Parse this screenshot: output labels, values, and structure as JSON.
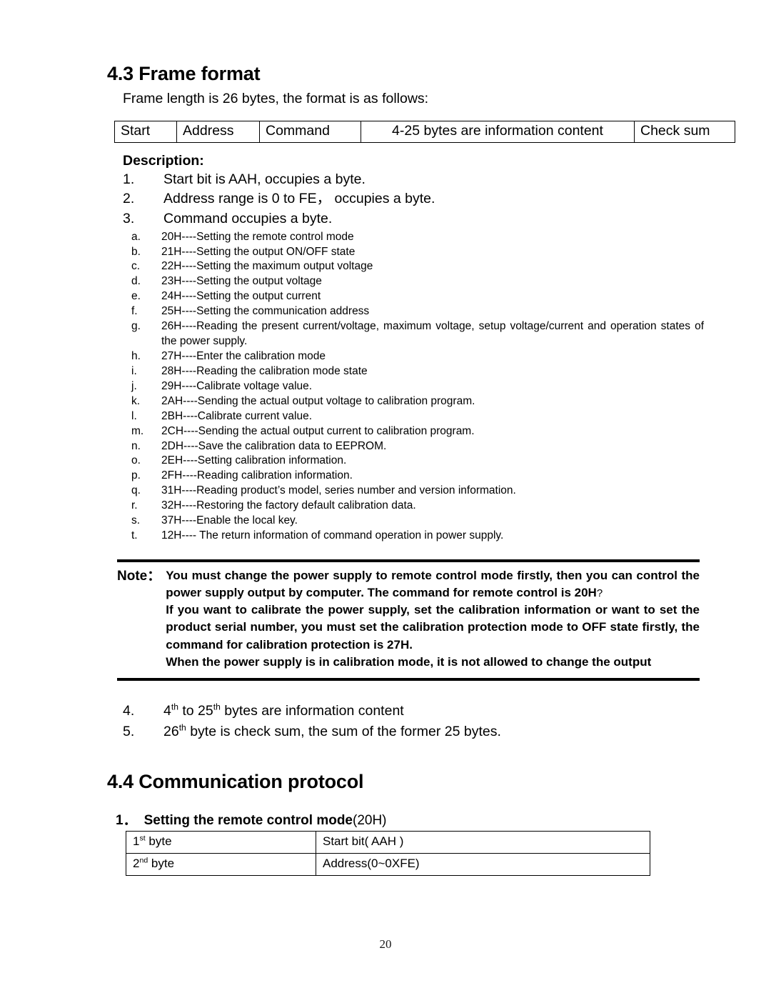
{
  "document": {
    "page_number": "20"
  },
  "section_43": {
    "heading": "4.3 Frame format",
    "intro": "Frame length is 26 bytes, the format is as follows:",
    "frame_table": {
      "cells": [
        "Start",
        "Address",
        "Command",
        "4-25 bytes are information content",
        "Check sum"
      ]
    },
    "description_title": "Description:",
    "numbered_items": [
      {
        "num": "1.",
        "text": "Start bit is AAH, occupies a byte."
      },
      {
        "num": "2.",
        "text": "Address range is 0 to FE， occupies a byte."
      },
      {
        "num": "3.",
        "text": "Command occupies a byte."
      }
    ],
    "command_list": [
      {
        "letter": "a.",
        "text": "20H----Setting the remote control mode"
      },
      {
        "letter": "b.",
        "text": "21H----Setting the output ON/OFF state"
      },
      {
        "letter": "c.",
        "text": "22H----Setting the maximum output voltage"
      },
      {
        "letter": "d.",
        "text": "23H----Setting the output voltage"
      },
      {
        "letter": "e.",
        "text": "24H----Setting the output current"
      },
      {
        "letter": "f.",
        "text": "25H----Setting the communication address"
      },
      {
        "letter": "g.",
        "text": "26H----Reading the present current/voltage, maximum voltage, setup voltage/current and operation states of the power supply."
      },
      {
        "letter": "h.",
        "text": "27H----Enter the calibration mode"
      },
      {
        "letter": "i.",
        "text": "28H----Reading the calibration mode state"
      },
      {
        "letter": "j.",
        "text": "29H----Calibrate voltage value."
      },
      {
        "letter": "k.",
        "text": "2AH----Sending the actual output voltage to calibration program."
      },
      {
        "letter": "l.",
        "text": "2BH----Calibrate current value."
      },
      {
        "letter": "m.",
        "text": "2CH----Sending the actual output current to calibration program."
      },
      {
        "letter": "n.",
        "text": "2DH----Save the calibration data to EEPROM."
      },
      {
        "letter": "o.",
        "text": "2EH----Setting calibration information."
      },
      {
        "letter": "p.",
        "text": "2FH----Reading calibration information."
      },
      {
        "letter": "q.",
        "text": "31H----Reading product’s model, series number and version information."
      },
      {
        "letter": "r.",
        "text": "32H----Restoring the factory default calibration data."
      },
      {
        "letter": "s.",
        "text": "37H----Enable the local key."
      },
      {
        "letter": "t.",
        "text": "12H---- The return information of command operation in power supply."
      }
    ],
    "note": {
      "label": "Note：",
      "paragraph_1": "You must change the power supply to remote control mode firstly, then you can control the power supply output by computer.   The command for remote control is 20H",
      "paragraph_1_tail": "?",
      "paragraph_2": "If you want to calibrate the power supply, set the calibration information or   want to set the product serial number, you must set the calibration protection mode to OFF state firstly, the command for calibration protection is 27H.",
      "paragraph_3": "When the power supply is in calibration mode, it is not allowed to change the output"
    },
    "tail_items": [
      {
        "num": "4.",
        "parts": {
          "a": "4",
          "a_sup": "th",
          "b": " to 25",
          "b_sup": "th",
          "c": " bytes are information content"
        }
      },
      {
        "num": "5.",
        "parts": {
          "a": "26",
          "a_sup": "th",
          "b": " byte is check sum, the sum of the former 25 bytes.",
          "b_sup": "",
          "c": ""
        }
      }
    ]
  },
  "section_44": {
    "heading": "4.4 Communication protocol",
    "protocol_item": {
      "index": "1．",
      "title": "Setting the remote control mode",
      "code": "(20H)"
    },
    "byte_table": {
      "rows": [
        {
          "byte_label_num": "1",
          "byte_label_sup": "st",
          "byte_label_text": " byte",
          "value": "Start bit( AAH   )"
        },
        {
          "byte_label_num": "2",
          "byte_label_sup": "nd",
          "byte_label_text": " byte",
          "value": "Address(0~0XFE)"
        }
      ]
    }
  }
}
